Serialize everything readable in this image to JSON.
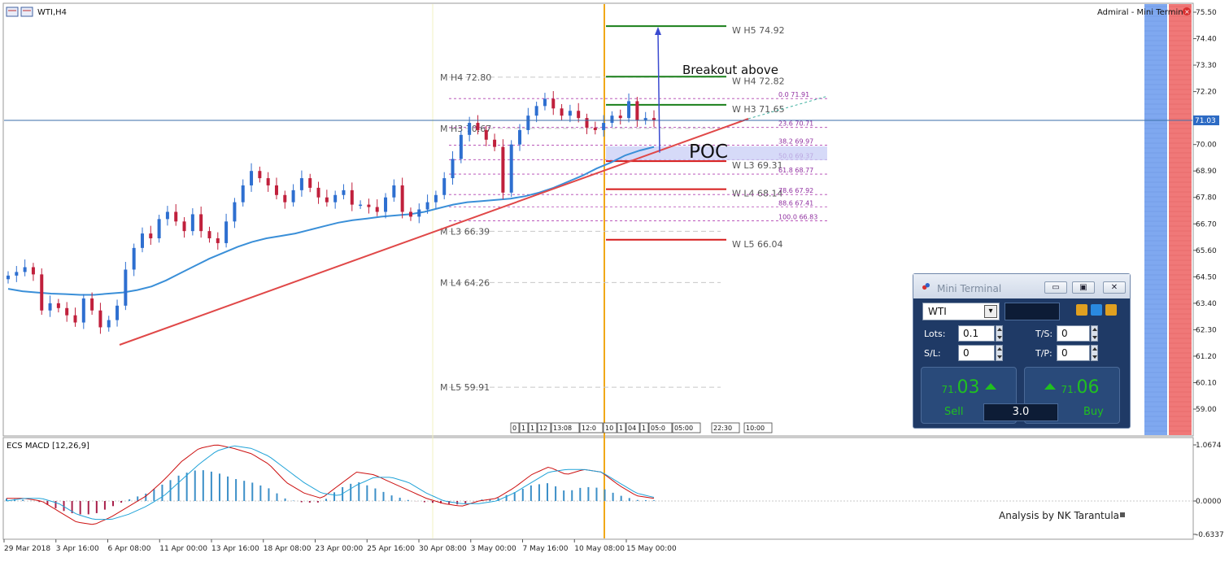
{
  "window": {
    "symbol_title": "WTI,H4",
    "broker_label": "Admiral - Mini Terminal",
    "indicator_title": "ECS MACD [12,26,9]",
    "footer_note": "Analysis by NK Tarantula"
  },
  "chart_data": [
    {
      "type": "candlestick",
      "title": "WTI,H4",
      "price_axis": {
        "ylim": [
          58.2,
          75.6
        ],
        "tick_labels": [
          "75.50",
          "74.40",
          "73.30",
          "72.20",
          "71.03",
          "70.00",
          "68.90",
          "67.80",
          "66.70",
          "65.60",
          "64.50",
          "63.40",
          "62.30",
          "61.20",
          "60.10",
          "59.00"
        ],
        "current_price": "71.03"
      },
      "time_axis": {
        "tick_labels": [
          "29 Mar 2018",
          "3 Apr 16:00",
          "6 Apr 08:00",
          "11 Apr 00:00",
          "13 Apr 16:00",
          "18 Apr 08:00",
          "23 Apr 00:00",
          "25 Apr 16:00",
          "30 Apr 08:00",
          "3 May 00:00",
          "7 May 16:00",
          "10 May 08:00",
          "15 May 00:00"
        ],
        "session_boxes": [
          "0",
          "1",
          "1",
          "12",
          "13:08",
          "12:0",
          "10",
          "1",
          "04",
          "1",
          "05:0",
          "05:00",
          "22:30",
          "10:00"
        ]
      },
      "close_series": [
        64.55,
        64.7,
        64.9,
        64.6,
        63.1,
        63.4,
        63.2,
        62.9,
        62.6,
        63.6,
        63.1,
        62.4,
        62.7,
        63.3,
        64.8,
        65.7,
        66.3,
        66.1,
        66.9,
        67.2,
        66.8,
        66.4,
        67.1,
        66.4,
        66.1,
        65.9,
        66.8,
        67.6,
        68.3,
        68.9,
        68.6,
        68.3,
        67.9,
        67.6,
        68.1,
        68.6,
        68.2,
        67.8,
        67.6,
        67.9,
        68.1,
        67.5,
        67.5,
        67.4,
        67.2,
        67.8,
        68.3,
        67.2,
        67.0,
        67.3,
        67.6,
        67.9,
        68.6,
        69.4,
        70.4,
        70.9,
        70.6,
        70.2,
        69.9,
        68.0,
        70.0,
        70.6,
        71.2,
        71.6,
        71.9,
        71.5,
        71.2,
        71.4,
        71.1,
        70.7,
        70.6,
        70.9,
        71.2,
        71.1,
        71.8,
        71.0,
        71.1,
        71.0
      ],
      "ma_series": [
        64.0,
        63.9,
        63.85,
        63.8,
        63.78,
        63.75,
        63.75,
        63.8,
        63.85,
        63.95,
        64.1,
        64.35,
        64.65,
        64.95,
        65.25,
        65.5,
        65.75,
        65.95,
        66.1,
        66.2,
        66.3,
        66.45,
        66.6,
        66.75,
        66.85,
        66.92,
        67.0,
        67.05,
        67.1,
        67.2,
        67.35,
        67.5,
        67.6,
        67.65,
        67.7,
        67.75,
        67.85,
        68.0,
        68.2,
        68.45,
        68.7,
        69.0,
        69.25,
        69.55,
        69.75,
        69.9
      ],
      "pivot_levels_weekly": [
        {
          "label": "W  H5 74.92",
          "value": 74.92,
          "color": "#1a7f1a"
        },
        {
          "label": "W  H4 72.82",
          "value": 72.82,
          "color": "#1a7f1a"
        },
        {
          "label": "W  H3 71.65",
          "value": 71.65,
          "color": "#1a7f1a"
        },
        {
          "label": "W  L3 69.31",
          "value": 69.31,
          "color": "#d61a1a"
        },
        {
          "label": "W  L4 68.14",
          "value": 68.14,
          "color": "#d61a1a"
        },
        {
          "label": "W  L5 66.04",
          "value": 66.04,
          "color": "#d61a1a"
        }
      ],
      "pivot_levels_monthly": [
        {
          "label": "M  H4 72.80",
          "value": 72.8
        },
        {
          "label": "M  H3 70.67",
          "value": 70.67
        },
        {
          "label": "M  L3 66.39",
          "value": 66.39
        },
        {
          "label": "M  L4 64.26",
          "value": 64.26
        },
        {
          "label": "M  L5 59.91",
          "value": 59.91
        }
      ],
      "fibonacci": [
        {
          "label": "0.0   71.91",
          "value": 71.91
        },
        {
          "label": "23.6   70.71",
          "value": 70.71
        },
        {
          "label": "38.2   69.97",
          "value": 69.97
        },
        {
          "label": "50.0   69.37",
          "value": 69.37
        },
        {
          "label": "61.8   68.77",
          "value": 68.77
        },
        {
          "label": "78.6   67.92",
          "value": 67.92
        },
        {
          "label": "88.6   67.41",
          "value": 67.41
        },
        {
          "label": "100.0   66.83",
          "value": 66.83
        }
      ],
      "annotations": {
        "breakout_text": "Breakout above",
        "poc_text": "POC"
      },
      "colors": {
        "bull": "#2e6fd0",
        "bear": "#c0203c",
        "ma": "#3a8fd8",
        "trendline": "#e04848"
      }
    },
    {
      "type": "macd",
      "title": "ECS MACD [12,26,9]",
      "axis_labels": [
        "1.0674",
        "0.0000",
        "-0.6337"
      ],
      "ylim": [
        -0.72,
        1.13
      ],
      "macd": [
        0.05,
        0.05,
        0.0,
        -0.2,
        -0.4,
        -0.45,
        -0.3,
        -0.1,
        0.1,
        0.4,
        0.75,
        1.0,
        1.07,
        1.0,
        0.9,
        0.7,
        0.35,
        0.15,
        0.05,
        0.3,
        0.55,
        0.5,
        0.35,
        0.2,
        0.05,
        -0.05,
        -0.1,
        0.0,
        0.05,
        0.25,
        0.5,
        0.65,
        0.5,
        0.6,
        0.55,
        0.3,
        0.1,
        0.05
      ],
      "signal": [
        0.0,
        0.05,
        0.05,
        -0.05,
        -0.25,
        -0.35,
        -0.35,
        -0.25,
        -0.1,
        0.1,
        0.4,
        0.7,
        0.95,
        1.05,
        1.0,
        0.85,
        0.6,
        0.35,
        0.15,
        0.1,
        0.3,
        0.45,
        0.45,
        0.35,
        0.15,
        0.0,
        -0.05,
        -0.05,
        0.0,
        0.15,
        0.35,
        0.55,
        0.6,
        0.6,
        0.55,
        0.35,
        0.15,
        0.07
      ],
      "colors": {
        "macd": "#cc1010",
        "signal": "#21a3d8",
        "hist_pos": "#3c8fc8",
        "hist_neg": "#a8204a"
      }
    }
  ],
  "mini_terminal": {
    "title": "Mini Terminal",
    "symbol": "WTI",
    "lots_label": "Lots:",
    "lots_value": "0.1",
    "sl_label": "S/L:",
    "sl_value": "0",
    "ts_label": "T/S:",
    "ts_value": "0",
    "tp_label": "T/P:",
    "tp_value": "0",
    "sell_price_small": "71.",
    "sell_price_big": "03",
    "buy_price_small": "71.",
    "buy_price_big": "06",
    "sell_label": "Sell",
    "buy_label": "Buy",
    "lot_size_display": "3.0"
  }
}
